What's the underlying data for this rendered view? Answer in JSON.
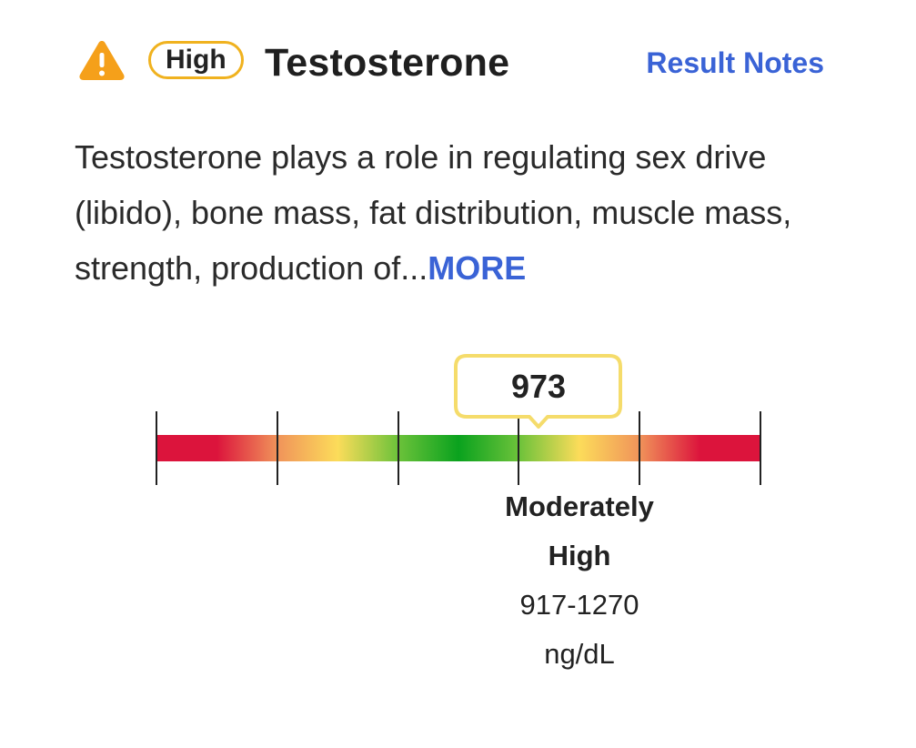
{
  "header": {
    "status_badge": "High",
    "title": "Testosterone",
    "result_notes_label": "Result Notes",
    "warning_icon": "warning-triangle-icon",
    "warning_color": "#f5a01a",
    "badge_border_color": "#f0b21f"
  },
  "description": {
    "text": "Testosterone plays a role in regulating sex drive (libido), bone mass, fat distribution, muscle mass, strength, production of...",
    "more_label": "MORE"
  },
  "result": {
    "value": "973",
    "value_number": 973,
    "callout_border_color": "#f5dc6b"
  },
  "range": {
    "name": "Moderately High",
    "values": "917-1270",
    "unit": "ng/dL",
    "selected_segment": 3,
    "segment_count": 5
  },
  "colors": {
    "link": "#3a63d6",
    "red": "#dc143c",
    "orange": "#f0935a",
    "yellow": "#fcdc5a",
    "green": "#0aa21e"
  }
}
